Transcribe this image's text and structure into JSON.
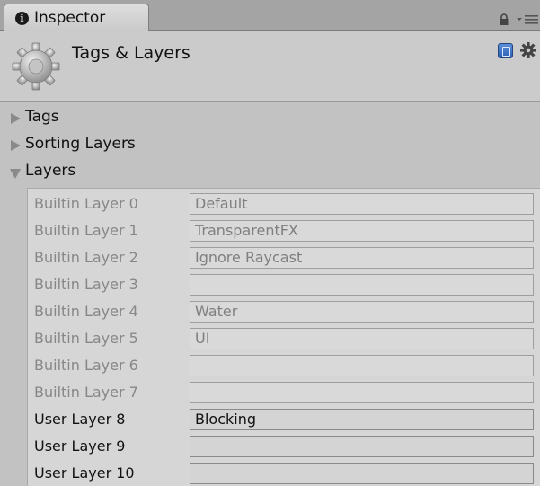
{
  "tab": {
    "label": "Inspector",
    "icon": "info-icon"
  },
  "header": {
    "title": "Tags & Layers",
    "icon": "gear-icon"
  },
  "foldouts": [
    {
      "label": "Tags",
      "expanded": false
    },
    {
      "label": "Sorting Layers",
      "expanded": false
    },
    {
      "label": "Layers",
      "expanded": true
    }
  ],
  "layers": [
    {
      "label": "Builtin Layer 0",
      "value": "Default",
      "editable": false
    },
    {
      "label": "Builtin Layer 1",
      "value": "TransparentFX",
      "editable": false
    },
    {
      "label": "Builtin Layer 2",
      "value": "Ignore Raycast",
      "editable": false
    },
    {
      "label": "Builtin Layer 3",
      "value": "",
      "editable": false
    },
    {
      "label": "Builtin Layer 4",
      "value": "Water",
      "editable": false
    },
    {
      "label": "Builtin Layer 5",
      "value": "UI",
      "editable": false
    },
    {
      "label": "Builtin Layer 6",
      "value": "",
      "editable": false
    },
    {
      "label": "Builtin Layer 7",
      "value": "",
      "editable": false
    },
    {
      "label": "User Layer 8",
      "value": "Blocking",
      "editable": true
    },
    {
      "label": "User Layer 9",
      "value": "",
      "editable": true
    },
    {
      "label": "User Layer 10",
      "value": "",
      "editable": true
    }
  ]
}
